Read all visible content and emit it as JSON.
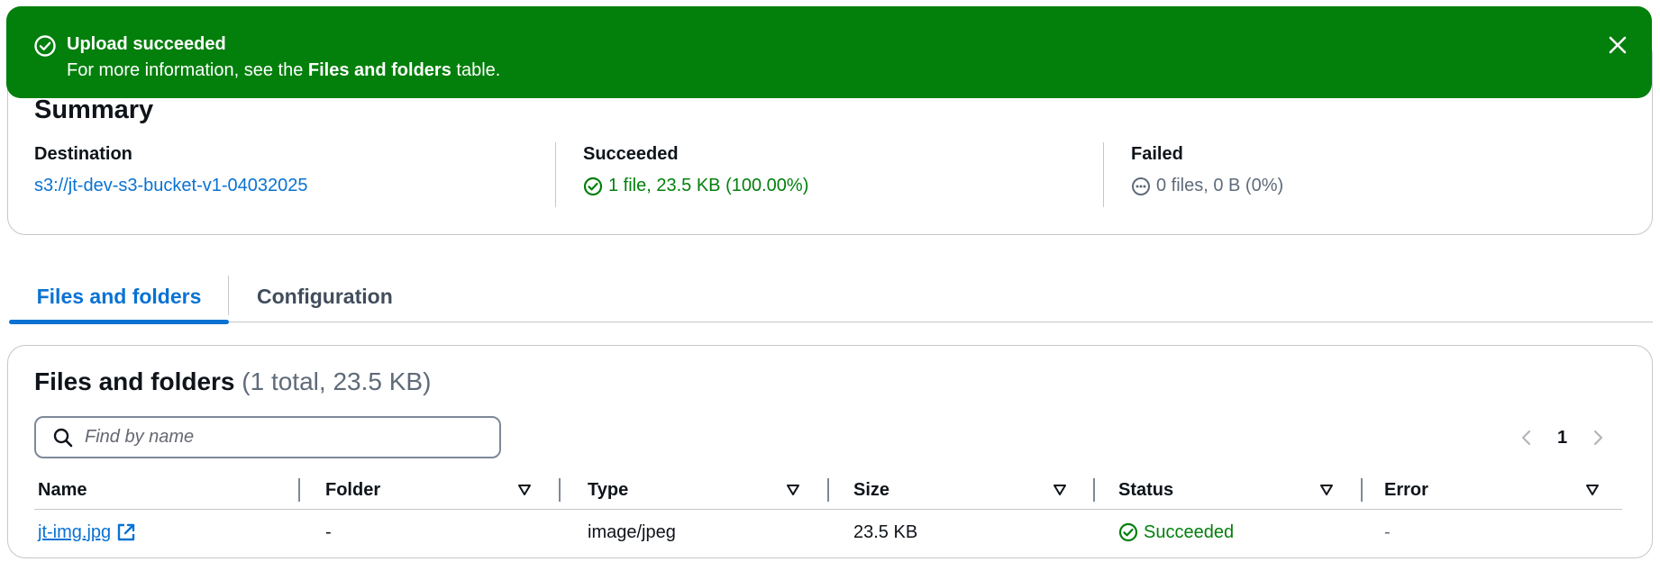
{
  "flash": {
    "title": "Upload succeeded",
    "message_prefix": "For more information, see the ",
    "message_bold": "Files and folders",
    "message_suffix": " table.",
    "status_icon": "check-circle-icon",
    "close_icon": "close-icon",
    "color": "#037f0c"
  },
  "summary": {
    "title": "Summary",
    "destination": {
      "label": "Destination",
      "value": "s3://jt-dev-s3-bucket-v1-04032025"
    },
    "succeeded": {
      "label": "Succeeded",
      "value": "1 file, 23.5 KB (100.00%)",
      "icon": "check-circle-icon"
    },
    "failed": {
      "label": "Failed",
      "value": "0 files, 0 B (0%)",
      "icon": "ellipsis-circle-icon"
    }
  },
  "tabs": [
    {
      "label": "Files and folders",
      "active": true
    },
    {
      "label": "Configuration",
      "active": false
    }
  ],
  "files": {
    "title": "Files and folders",
    "counter": "(1 total, 23.5 KB)",
    "search_placeholder": "Find by name",
    "pagination": {
      "current_page": "1"
    },
    "columns": [
      "Name",
      "Folder",
      "Type",
      "Size",
      "Status",
      "Error"
    ],
    "rows": [
      {
        "name": "jt-img.jpg",
        "folder": "-",
        "type": "image/jpeg",
        "size": "23.5 KB",
        "status": "Succeeded",
        "error": "-"
      }
    ]
  },
  "colors": {
    "accent": "#0972d3",
    "success": "#037f0c",
    "border": "#c6c6cd"
  }
}
